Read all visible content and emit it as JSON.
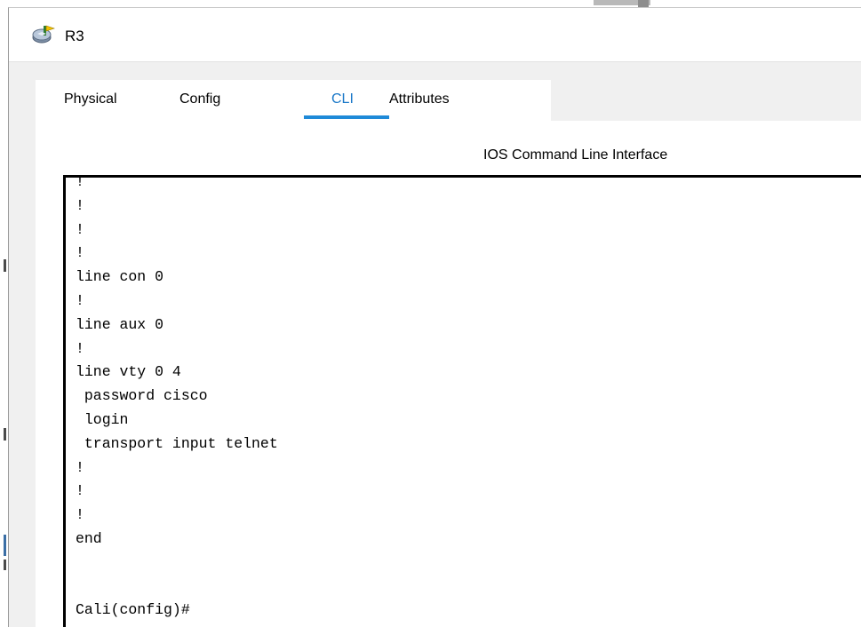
{
  "window": {
    "title": "R3"
  },
  "tabs": [
    {
      "label": "Physical",
      "active": false
    },
    {
      "label": "Config",
      "active": false
    },
    {
      "label": "CLI",
      "active": true
    },
    {
      "label": "Attributes",
      "active": false
    }
  ],
  "cli": {
    "heading": "IOS Command Line Interface",
    "lines": [
      "!",
      "!",
      "!",
      "!",
      "line con 0",
      "!",
      "line aux 0",
      "!",
      "line vty 0 4",
      " password cisco",
      " login",
      " transport input telnet",
      "!",
      "!",
      "!",
      "end",
      "",
      "",
      "Cali(config)#"
    ]
  },
  "colors": {
    "accent": "#1f8ad8",
    "active_tab_text": "#1a78c8",
    "window_bg": "#f0f0f0",
    "terminal_border": "#000000"
  },
  "icons": {
    "title_icon": "router-device-icon"
  }
}
